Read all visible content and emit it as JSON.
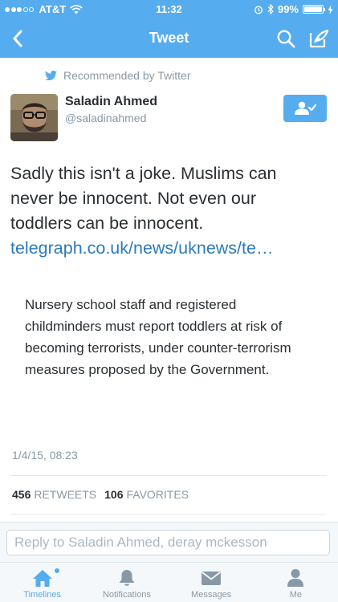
{
  "status_bar": {
    "carrier": "AT&T",
    "time": "11:32",
    "battery_percent": "99%",
    "battery_level": 0.99,
    "signal_bars_filled": 3,
    "signal_bars_total": 5
  },
  "nav": {
    "title": "Tweet",
    "back_icon": "chevron-left-icon",
    "search_icon": "search-icon",
    "compose_icon": "compose-icon"
  },
  "tweet": {
    "recommended_label": "Recommended by Twitter",
    "user": {
      "name": "Saladin Ahmed",
      "handle": "@saladinahmed"
    },
    "follow_icon": "follow-user-icon",
    "text_lines": [
      "Sadly this isn't a joke. Muslims can",
      "never be innocent. Not even our",
      "toddlers can be innocent."
    ],
    "link": "telegraph.co.uk/news/uknews/te…",
    "card_text": "Nursery school staff and registered childminders must report toddlers at risk of becoming terrorists, under counter-terrorism measures proposed by the Government.",
    "timestamp": "1/4/15, 08:23",
    "retweets_count": "456",
    "retweets_label": "RETWEETS",
    "favorites_count": "106",
    "favorites_label": "FAVORITES"
  },
  "reply": {
    "placeholder": "Reply to Saladin Ahmed, deray mckesson"
  },
  "tabs": [
    {
      "label": "Timelines",
      "icon": "home-icon",
      "active": true
    },
    {
      "label": "Notifications",
      "icon": "bell-icon",
      "active": false
    },
    {
      "label": "Messages",
      "icon": "envelope-icon",
      "active": false
    },
    {
      "label": "Me",
      "icon": "person-icon",
      "active": false
    }
  ],
  "colors": {
    "brand": "#55acee",
    "link": "#2b7bb9",
    "text": "#292f33",
    "muted": "#8899a6"
  }
}
